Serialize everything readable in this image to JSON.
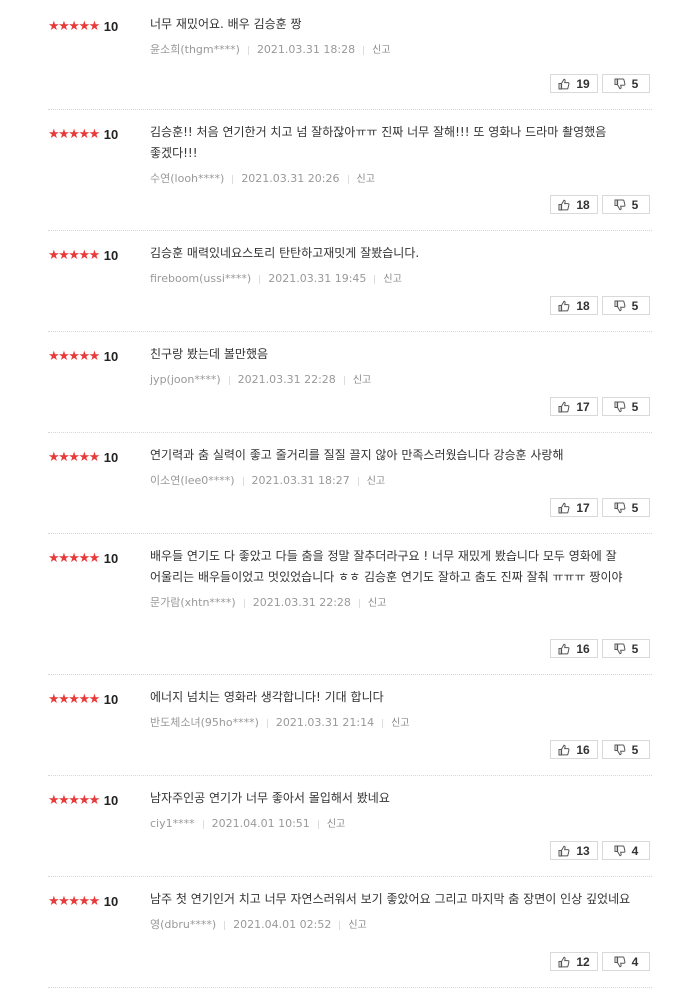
{
  "labels": {
    "report": "신고"
  },
  "icons": {
    "like": "thumbs-up-icon",
    "dislike": "thumbs-down-icon",
    "star": "star-icon"
  },
  "colors": {
    "star": "#e93a3a"
  },
  "reviews": [
    {
      "score": "10",
      "stars": 5,
      "text": "너무 재밌어요. 배우 김승훈 짱",
      "author": "윤소희(thgm****)",
      "date": "2021.03.31 18:28",
      "likes": "19",
      "dislikes": "5"
    },
    {
      "score": "10",
      "stars": 5,
      "text": "김승훈!! 처음 연기한거 치고 넘 잘하잖아ㅠㅠ 진짜 너무 잘해!!! 또 영화나 드라마 촬영했음 좋겠다!!!",
      "author": "수연(looh****)",
      "date": "2021.03.31 20:26",
      "likes": "18",
      "dislikes": "5"
    },
    {
      "score": "10",
      "stars": 5,
      "text": "김승훈 매력있네요스토리 탄탄하고재밋게 잘봤습니다.",
      "author": "fireboom(ussi****)",
      "date": "2021.03.31 19:45",
      "likes": "18",
      "dislikes": "5"
    },
    {
      "score": "10",
      "stars": 5,
      "text": "친구랑 봤는데 볼만했음",
      "author": "jyp(joon****)",
      "date": "2021.03.31 22:28",
      "likes": "17",
      "dislikes": "5"
    },
    {
      "score": "10",
      "stars": 5,
      "text": "연기력과 춤 실력이 좋고 줄거리를 질질 끌지 않아 만족스러웠습니다 강승훈 사랑해",
      "author": "이소연(lee0****)",
      "date": "2021.03.31 18:27",
      "likes": "17",
      "dislikes": "5"
    },
    {
      "score": "10",
      "stars": 5,
      "text": "배우들 연기도 다 좋았고 다들 춤을 정말 잘추더라구요 ! 너무 재밌게 봤습니다 모두 영화에 잘 어울리는 배우들이었고 멋있었습니다 ㅎㅎ 김승훈 연기도 잘하고 춤도 진짜 잘춰 ㅠㅠㅠ 짱이야",
      "author": "문가람(xhtn****)",
      "date": "2021.03.31 22:28",
      "likes": "16",
      "dislikes": "5"
    },
    {
      "score": "10",
      "stars": 5,
      "text": "에너지 넘치는 영화라 생각합니다! 기대 합니다",
      "author": "반도체소녀(95ho****)",
      "date": "2021.03.31 21:14",
      "likes": "16",
      "dislikes": "5"
    },
    {
      "score": "10",
      "stars": 5,
      "text": "남자주인공 연기가 너무 좋아서 몰입해서 봤네요",
      "author": "ciy1****",
      "date": "2021.04.01 10:51",
      "likes": "13",
      "dislikes": "4"
    },
    {
      "score": "10",
      "stars": 5,
      "text": "남주 첫 연기인거 치고 너무 자연스러워서 보기 좋았어요 그리고 마지막 춤 장면이 인상 깊었네요",
      "author": "영(dbru****)",
      "date": "2021.04.01 02:52",
      "likes": "12",
      "dislikes": "4"
    }
  ]
}
